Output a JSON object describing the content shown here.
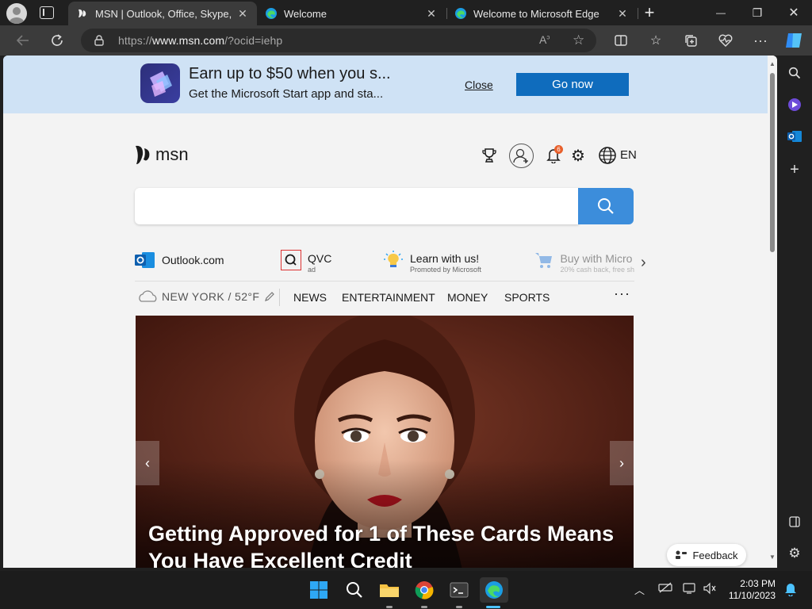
{
  "tabs": [
    {
      "title": "MSN | Outlook, Office, Skype, Bing",
      "close": "✕"
    },
    {
      "title": "Welcome",
      "close": "✕"
    },
    {
      "title": "Welcome to Microsoft Edge",
      "close": "✕"
    }
  ],
  "new_tab": "+",
  "window": {
    "minimize": "—",
    "maximize": "❐",
    "close": "✕"
  },
  "address": {
    "prefix": "https://",
    "domain": "www.msn.com",
    "path": "/?ocid=iehp"
  },
  "banner": {
    "title": "Earn up to $50 when you s...",
    "subtitle": "Get the Microsoft Start app and sta...",
    "close_label": "Close",
    "go_label": "Go now"
  },
  "msn": {
    "logo_text": "msn",
    "notification_count": "6",
    "language": "EN"
  },
  "quick_links": [
    {
      "label": "Outlook.com",
      "sub": ""
    },
    {
      "label": "QVC",
      "sub": "ad"
    },
    {
      "label": "Learn with us!",
      "sub": "Promoted by Microsoft"
    },
    {
      "label": "Buy with Micro",
      "sub": "20% cash back, free sh"
    }
  ],
  "weather": {
    "location": "NEW YORK / 52°F"
  },
  "nav": [
    "NEWS",
    "ENTERTAINMENT",
    "MONEY",
    "SPORTS"
  ],
  "nav_more": "···",
  "hero": {
    "title": "Getting Approved for 1 of These Cards Means You Have Excellent Credit",
    "prev": "‹",
    "next": "›"
  },
  "feedback_label": "Feedback",
  "clock": {
    "time": "2:03 PM",
    "date": "11/10/2023"
  },
  "colors": {
    "accent": "#0f6cbd",
    "search": "#3c8ddb",
    "banner": "#cfe2f5"
  }
}
